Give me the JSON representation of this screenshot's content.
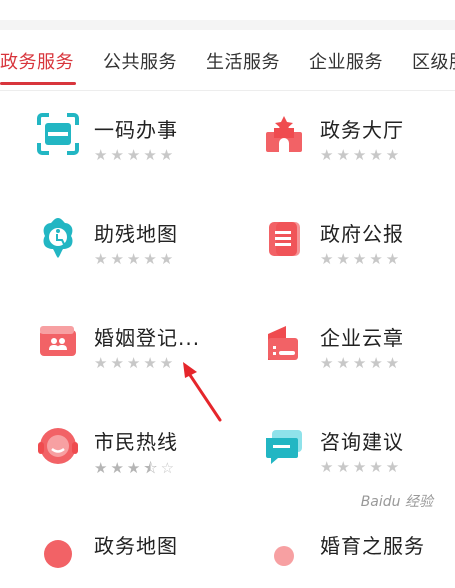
{
  "tabs": [
    {
      "label": "政务服务",
      "active": true
    },
    {
      "label": "公共服务",
      "active": false
    },
    {
      "label": "生活服务",
      "active": false
    },
    {
      "label": "企业服务",
      "active": false
    },
    {
      "label": "区级服",
      "active": false
    }
  ],
  "services": [
    {
      "name": "一码办事",
      "rating": 0,
      "icon": "qr-scan-icon"
    },
    {
      "name": "政务大厅",
      "rating": 0,
      "icon": "government-hall-icon"
    },
    {
      "name": "助残地图",
      "rating": 0,
      "icon": "disability-map-icon"
    },
    {
      "name": "政府公报",
      "rating": 0,
      "icon": "gazette-document-icon"
    },
    {
      "name": "婚姻登记...",
      "rating": 0,
      "icon": "marriage-registration-icon"
    },
    {
      "name": "企业云章",
      "rating": 0,
      "icon": "enterprise-seal-icon"
    },
    {
      "name": "市民热线",
      "rating": 3.5,
      "icon": "hotline-headset-icon"
    },
    {
      "name": "咨询建议",
      "rating": 0,
      "icon": "consult-chat-icon"
    },
    {
      "name": "政务地图",
      "rating": 0,
      "icon": "government-map-icon"
    },
    {
      "name": "婚育之服务",
      "rating": 0,
      "icon": "maternity-service-icon"
    }
  ],
  "colors": {
    "accent": "#d8353c",
    "star_empty": "#c8c8c8",
    "star_filled": "#bdbdbd",
    "arrow": "#e5262b"
  }
}
